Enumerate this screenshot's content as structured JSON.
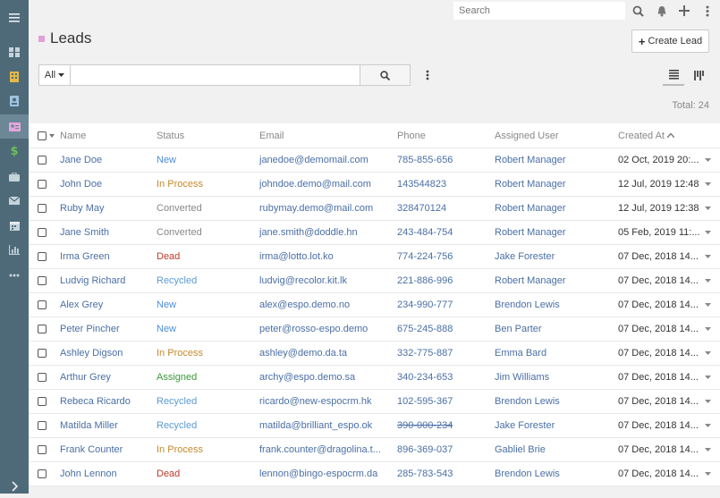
{
  "topbar": {
    "search_placeholder": "Search"
  },
  "page": {
    "title": "Leads",
    "create_label": "Create Lead"
  },
  "filter": {
    "scope_label": "All",
    "text_value": ""
  },
  "total_label": "Total: 24",
  "table": {
    "headers": {
      "name": "Name",
      "status": "Status",
      "email": "Email",
      "phone": "Phone",
      "assigned": "Assigned User",
      "created": "Created At"
    },
    "rows": [
      {
        "name": "Jane Doe",
        "status": "New",
        "email": "janedoe@demomail.com",
        "phone": "785-855-656",
        "assigned": "Robert Manager",
        "created": "02 Oct, 2019 20:..."
      },
      {
        "name": "John Doe",
        "status": "In Process",
        "email": "johndoe.demo@mail.com",
        "phone": "143544823",
        "assigned": "Robert Manager",
        "created": "12 Jul, 2019 12:48"
      },
      {
        "name": "Ruby May",
        "status": "Converted",
        "email": "rubymay.demo@mail.com",
        "phone": "328470124",
        "assigned": "Robert Manager",
        "created": "12 Jul, 2019 12:38"
      },
      {
        "name": "Jane Smith",
        "status": "Converted",
        "email": "jane.smith@doddle.hn",
        "phone": "243-484-754",
        "assigned": "Robert Manager",
        "created": "05 Feb, 2019 11:..."
      },
      {
        "name": "Irma Green",
        "status": "Dead",
        "email": "irma@lotto.lot.ko",
        "phone": "774-224-756",
        "assigned": "Jake Forester",
        "created": "07 Dec, 2018 14..."
      },
      {
        "name": "Ludvig Richard",
        "status": "Recycled",
        "email": "ludvig@recolor.kit.lk",
        "phone": "221-886-996",
        "assigned": "Robert Manager",
        "created": "07 Dec, 2018 14..."
      },
      {
        "name": "Alex Grey",
        "status": "New",
        "email": "alex@espo.demo.no",
        "phone": "234-990-777",
        "assigned": "Brendon Lewis",
        "created": "07 Dec, 2018 14..."
      },
      {
        "name": "Peter Pincher",
        "status": "New",
        "email": "peter@rosso-espo.demo",
        "phone": "675-245-888",
        "assigned": "Ben Parter",
        "created": "07 Dec, 2018 14..."
      },
      {
        "name": "Ashley Digson",
        "status": "In Process",
        "email": "ashley@demo.da.ta",
        "phone": "332-775-887",
        "assigned": "Emma Bard",
        "created": "07 Dec, 2018 14..."
      },
      {
        "name": "Arthur Grey",
        "status": "Assigned",
        "email": "archy@espo.demo.sa",
        "phone": "340-234-653",
        "assigned": "Jim Williams",
        "created": "07 Dec, 2018 14..."
      },
      {
        "name": "Rebeca Ricardo",
        "status": "Recycled",
        "email": "ricardo@new-espocrm.hk",
        "phone": "102-595-367",
        "assigned": "Brendon Lewis",
        "created": "07 Dec, 2018 14..."
      },
      {
        "name": "Matilda Miller",
        "status": "Recycled",
        "email": "matilda@brilliant_espo.ok",
        "phone": "390-000-234",
        "phone_struck": true,
        "assigned": "Jake Forester",
        "created": "07 Dec, 2018 14..."
      },
      {
        "name": "Frank Counter",
        "status": "In Process",
        "email": "frank.counter@dragolina.t...",
        "phone": "896-369-037",
        "assigned": "Gabliel Brie",
        "created": "07 Dec, 2018 14..."
      },
      {
        "name": "John Lennon",
        "status": "Dead",
        "email": "lennon@bingo-espocrm.da",
        "phone": "285-783-543",
        "assigned": "Brendon Lewis",
        "created": "07 Dec, 2018 14..."
      }
    ]
  },
  "colors": {
    "sidebar": "#4e6a78",
    "status_new": "#4a8fd6",
    "status_in_process": "#c68a2c",
    "status_converted": "#888888",
    "status_dead": "#c0392b",
    "status_recycled": "#5a9bd6",
    "status_assigned": "#3a9a3a"
  },
  "sidebar_icons": [
    "menu-icon",
    "dashboard-icon",
    "accounts-icon",
    "contacts-icon",
    "leads-icon",
    "opportunities-icon",
    "cases-icon",
    "email-icon",
    "calendar-icon",
    "reports-icon",
    "more-icon",
    "expand-icon"
  ]
}
